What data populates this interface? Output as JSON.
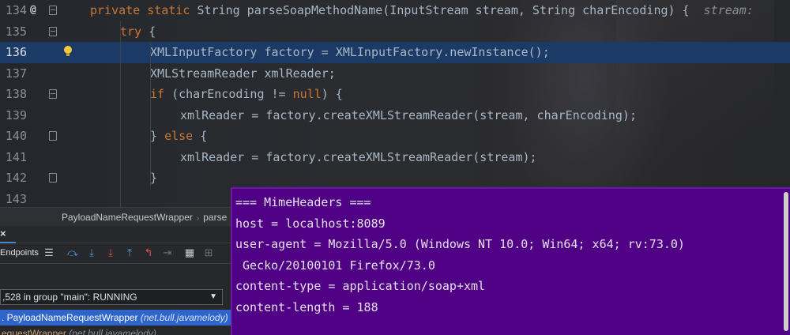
{
  "editor": {
    "lines": [
      {
        "num": "134",
        "tokens": [
          {
            "t": "private static ",
            "k": "kw"
          },
          {
            "t": "String parseSoapMethodName(InputStream stream, String charEncoding) {  ",
            "k": ""
          },
          {
            "t": "stream:",
            "k": "hint"
          }
        ]
      },
      {
        "num": "135",
        "tokens": [
          {
            "t": "try ",
            "k": "kw"
          },
          {
            "t": "{",
            "k": ""
          }
        ]
      },
      {
        "num": "136",
        "tokens": [
          {
            "t": "XMLInputFactory factory = XMLInputFactory.newInstance();",
            "k": ""
          }
        ]
      },
      {
        "num": "137",
        "tokens": [
          {
            "t": "XMLStreamReader xmlReader;",
            "k": ""
          }
        ]
      },
      {
        "num": "138",
        "tokens": [
          {
            "t": "if ",
            "k": "kw"
          },
          {
            "t": "(charEncoding != ",
            "k": ""
          },
          {
            "t": "null",
            "k": "kw"
          },
          {
            "t": ") {",
            "k": ""
          }
        ]
      },
      {
        "num": "139",
        "tokens": [
          {
            "t": "xmlReader = factory.createXMLStreamReader(stream, charEncoding);",
            "k": ""
          }
        ]
      },
      {
        "num": "140",
        "tokens": [
          {
            "t": "} ",
            "k": ""
          },
          {
            "t": "else ",
            "k": "kw"
          },
          {
            "t": "{",
            "k": ""
          }
        ]
      },
      {
        "num": "141",
        "tokens": [
          {
            "t": "xmlReader = factory.createXMLStreamReader(stream);",
            "k": ""
          }
        ]
      },
      {
        "num": "142",
        "tokens": [
          {
            "t": "}",
            "k": ""
          }
        ]
      },
      {
        "num": "143",
        "tokens": []
      }
    ],
    "gutter_icon_at_sign": "@",
    "current_line": "136"
  },
  "breadcrumb": {
    "class_name": "PayloadNameRequestWrapper",
    "method_name": "parse"
  },
  "debug": {
    "close_symbol": "×",
    "tab_label": "Endpoints",
    "thread_label": ",528 in group \"main\": RUNNING",
    "frames": [
      {
        "name": ". PayloadNameRequestWrapper ",
        "pkg": "(net.bull.javamelody)"
      },
      {
        "name": "equestWrapper ",
        "pkg": "(net.bull.javamelody)"
      }
    ]
  },
  "tooltip": {
    "lines": [
      "=== MimeHeaders ===",
      "host = localhost:8089",
      "user-agent = Mozilla/5.0 (Windows NT 10.0; Win64; x64; rv:73.0)",
      " Gecko/20100101 Firefox/73.0",
      "content-type = application/soap+xml",
      "content-length = 188"
    ]
  },
  "icons": {
    "toolbar": [
      "list-icon",
      "step-over-icon",
      "step-into-icon",
      "force-step-into-icon",
      "step-out-icon",
      "drop-frame-icon",
      "run-to-cursor-icon",
      "evaluate-icon",
      "trace-icon"
    ],
    "gutter": [
      "override-at-icon",
      "bulb-icon"
    ]
  },
  "colors": {
    "current_line": "#1b3a66",
    "keyword": "#cc7832",
    "tooltip_bg": "#4f0084",
    "frame_selected": "#2f65ca"
  }
}
